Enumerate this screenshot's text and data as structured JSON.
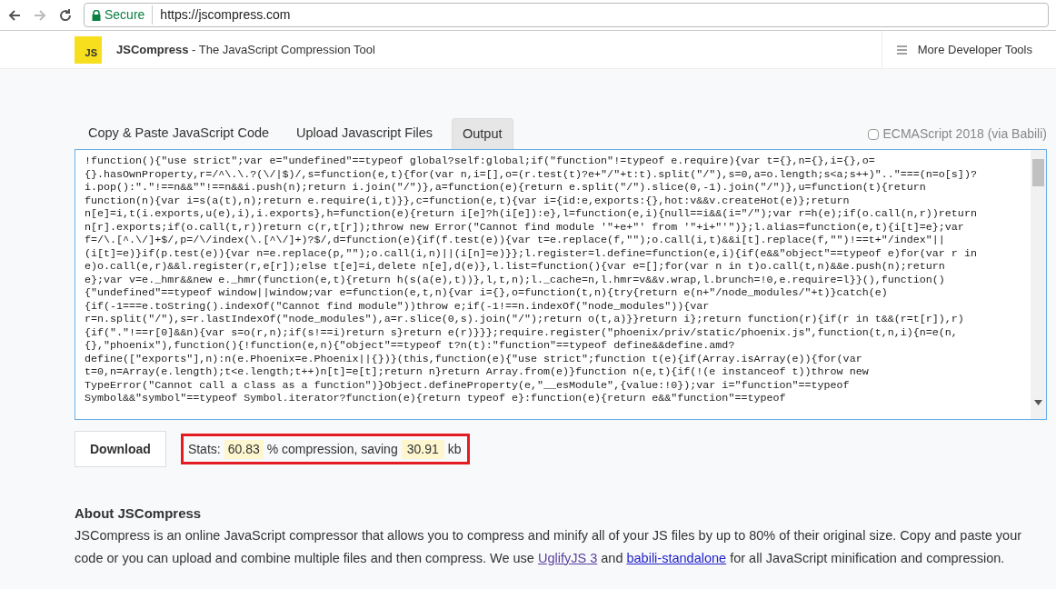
{
  "browser": {
    "security": "Secure",
    "url": "https://jscompress.com"
  },
  "header": {
    "logo": "JS",
    "brand": "JSCompress",
    "tagline": "- The JavaScript Compression Tool",
    "menu_button": "More Developer Tools"
  },
  "tabs": [
    {
      "label": "Copy & Paste JavaScript Code",
      "selected": false
    },
    {
      "label": "Upload Javascript Files",
      "selected": false
    },
    {
      "label": "Output",
      "selected": true
    }
  ],
  "ecmascript_option": {
    "label": "ECMAScript 2018 (via Babili)",
    "checked": false
  },
  "output_lines": [
    "!function(){\"use strict\";var e=\"undefined\"==typeof global?self:global;if(\"function\"!=typeof e.require){var t={},n={},i={},o=",
    "{}.hasOwnProperty,r=/^\\.\\.?(\\/|$)/,s=function(e,t){for(var n,i=[],o=(r.test(t)?e+\"/\"+t:t).split(\"/\"),s=0,a=o.length;s<a;s++)\"..\"===(n=o[s])?",
    "i.pop():\".\"!==n&&\"\"!==n&&i.push(n);return i.join(\"/\")},a=function(e){return e.split(\"/\").slice(0,-1).join(\"/\")},u=function(t){return",
    "function(n){var i=s(a(t),n);return e.require(i,t)}},c=function(e,t){var i={id:e,exports:{},hot:v&&v.createHot(e)};return",
    "n[e]=i,t(i.exports,u(e),i),i.exports},h=function(e){return i[e]?h(i[e]):e},l=function(e,i){null==i&&(i=\"/\");var r=h(e);if(o.call(n,r))return",
    "n[r].exports;if(o.call(t,r))return c(r,t[r]);throw new Error(\"Cannot find module '\"+e+\"' from '\"+i+\"'\")};l.alias=function(e,t){i[t]=e};var",
    "f=/\\.[^.\\/]+$/,p=/\\/index(\\.[^\\/]+)?$/,d=function(e){if(f.test(e)){var t=e.replace(f,\"\");o.call(i,t)&&i[t].replace(f,\"\")!==t+\"/index\"||",
    "(i[t]=e)}if(p.test(e)){var n=e.replace(p,\"\");o.call(i,n)||(i[n]=e)}};l.register=l.define=function(e,i){if(e&&\"object\"==typeof e)for(var r in",
    "e)o.call(e,r)&&l.register(r,e[r]);else t[e]=i,delete n[e],d(e)},l.list=function(){var e=[];for(var n in t)o.call(t,n)&&e.push(n);return",
    "e};var v=e._hmr&&new e._hmr(function(e,t){return h(s(a(e),t))},l,t,n);l._cache=n,l.hmr=v&&v.wrap,l.brunch=!0,e.require=l}}(),function()",
    "{\"undefined\"==typeof window||window;var e=function(e,t,n){var i={},o=function(t,n){try{return e(n+\"/node_modules/\"+t)}catch(e)",
    "{if(-1===e.toString().indexOf(\"Cannot find module\"))throw e;if(-1!==n.indexOf(\"node_modules\")){var",
    "r=n.split(\"/\"),s=r.lastIndexOf(\"node_modules\"),a=r.slice(0,s).join(\"/\");return o(t,a)}}return i};return function(r){if(r in t&&(r=t[r]),r)",
    "{if(\".\"!==r[0]&&n){var s=o(r,n);if(s!==i)return s}return e(r)}}};require.register(\"phoenix/priv/static/phoenix.js\",function(t,n,i){n=e(n,",
    "{},\"phoenix\"),function(){!function(e,n){\"object\"==typeof t?n(t):\"function\"==typeof define&&define.amd?",
    "define([\"exports\"],n):n(e.Phoenix=e.Phoenix||{})}(this,function(e){\"use strict\";function t(e){if(Array.isArray(e)){for(var",
    "t=0,n=Array(e.length);t<e.length;t++)n[t]=e[t];return n}return Array.from(e)}function n(e,t){if(!(e instanceof t))throw new",
    "TypeError(\"Cannot call a class as a function\")}Object.defineProperty(e,\"__esModule\",{value:!0});var i=\"function\"==typeof",
    "Symbol&&\"symbol\"==typeof Symbol.iterator?function(e){return typeof e}:function(e){return e&&\"function\"==typeof"
  ],
  "download_button": "Download",
  "stats": {
    "label": "Stats:",
    "compression_value": "60.83",
    "compression_text": "% compression, saving",
    "saving_value": "30.91",
    "saving_unit": "kb"
  },
  "about": {
    "title": "About JSCompress",
    "text_before": "JSCompress is an online JavaScript compressor that allows you to compress and minify all of your JS files by up to 80% of their original size. Copy and paste your code or you can upload and combine multiple files and then compress. We use",
    "link_1": "UglifyJS 3",
    "text_middle": "and",
    "link_2": "babili-standalone",
    "text_after": "for all JavaScript minification and compression."
  }
}
